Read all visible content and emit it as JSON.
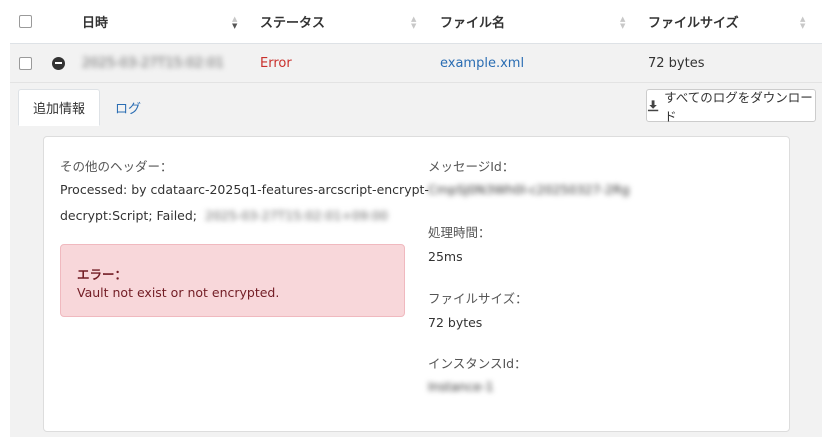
{
  "table": {
    "headers": {
      "datetime": "日時",
      "status": "ステータス",
      "filename": "ファイル名",
      "filesize": "ファイルサイズ"
    },
    "row": {
      "datetime": "2025-03-27T15:02:01",
      "status": "Error",
      "filename": "example.xml",
      "filesize": "72 bytes"
    }
  },
  "details": {
    "tabs": {
      "info": "追加情報",
      "log": "ログ"
    },
    "download_label": "すべてのログをダウンロード",
    "other_headers_label": "その他のヘッダー：",
    "processed_text": "Processed: by cdataarc-2025q1-features-arcscript-encrypt-decrypt:Script; Failed;",
    "processed_line1": "Processed: by cdataarc-2025q1-features-arcscript-encrypt-",
    "processed_line2": "decrypt:Script; Failed;",
    "processed_hidden": "2025-03-27T15:02:01+09:00",
    "error_title": "エラー：",
    "error_message": "Vault not exist or not encrypted.",
    "message_id_label": "メッセージId：",
    "message_id_value": "CmpSJ0N3Wh0l-c20250327-2Rg",
    "processing_time_label": "処理時間：",
    "processing_time_value": "25ms",
    "filesize_label": "ファイルサイズ：",
    "filesize_value": "72 bytes",
    "instance_id_label": "インスタンスId：",
    "instance_id_value": "Instance-1"
  },
  "colors": {
    "error_text": "#c9302c",
    "link": "#2a6db3",
    "error_bg": "#f8d7da",
    "error_fg": "#721c24"
  }
}
